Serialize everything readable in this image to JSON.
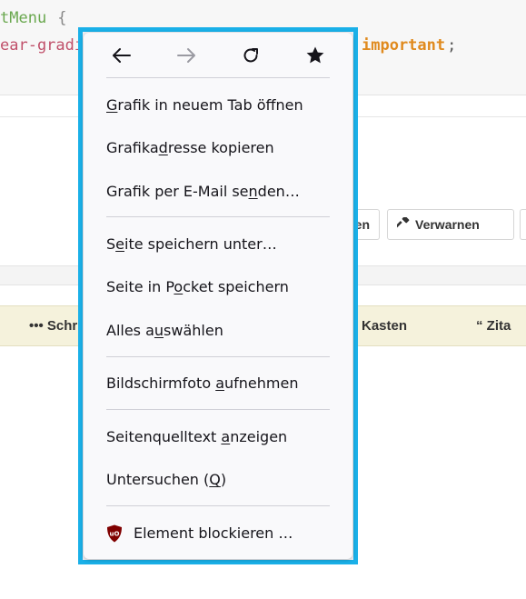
{
  "background": {
    "code_line1": "tMenu",
    "code_brace": "{",
    "code_line2": "ear-gradi",
    "code_important": "important",
    "code_semicolon": ";",
    "buttons": {
      "partial_left_label": "en",
      "warn_label": "Verwarnen"
    },
    "toolbar": {
      "schr_label": "••• Schr",
      "kasten_label": "Kasten",
      "zitat_label": "“ Zita"
    }
  },
  "context_menu": {
    "nav": {
      "back_icon": "back-arrow-icon",
      "forward_icon": "forward-arrow-icon",
      "reload_icon": "reload-icon",
      "bookmark_icon": "star-icon",
      "forward_enabled": false
    },
    "items": [
      {
        "pre": "",
        "u": "G",
        "post": "rafik in neuem Tab öffnen"
      },
      {
        "pre": "Grafika",
        "u": "d",
        "post": "resse kopieren"
      },
      {
        "pre": "Grafik per E-Mail se",
        "u": "n",
        "post": "den…"
      },
      {
        "pre": "S",
        "u": "e",
        "post": "ite speichern unter…"
      },
      {
        "pre": "Seite in P",
        "u": "o",
        "post": "cket speichern"
      },
      {
        "pre": "Alles a",
        "u": "u",
        "post": "swählen"
      },
      {
        "pre": "Bildschirmfoto ",
        "u": "a",
        "post": "ufnehmen"
      },
      {
        "pre": "Seitenquelltext ",
        "u": "a",
        "post": "nzeigen"
      },
      {
        "pre": "Untersuchen (",
        "u": "Q",
        "post": ")"
      },
      {
        "pre": "Element blockieren …",
        "u": "",
        "post": ""
      }
    ],
    "ublock_badge_text": "uO",
    "colors": {
      "highlight_border": "#1ab0e8",
      "ublock_red": "#800000"
    }
  }
}
